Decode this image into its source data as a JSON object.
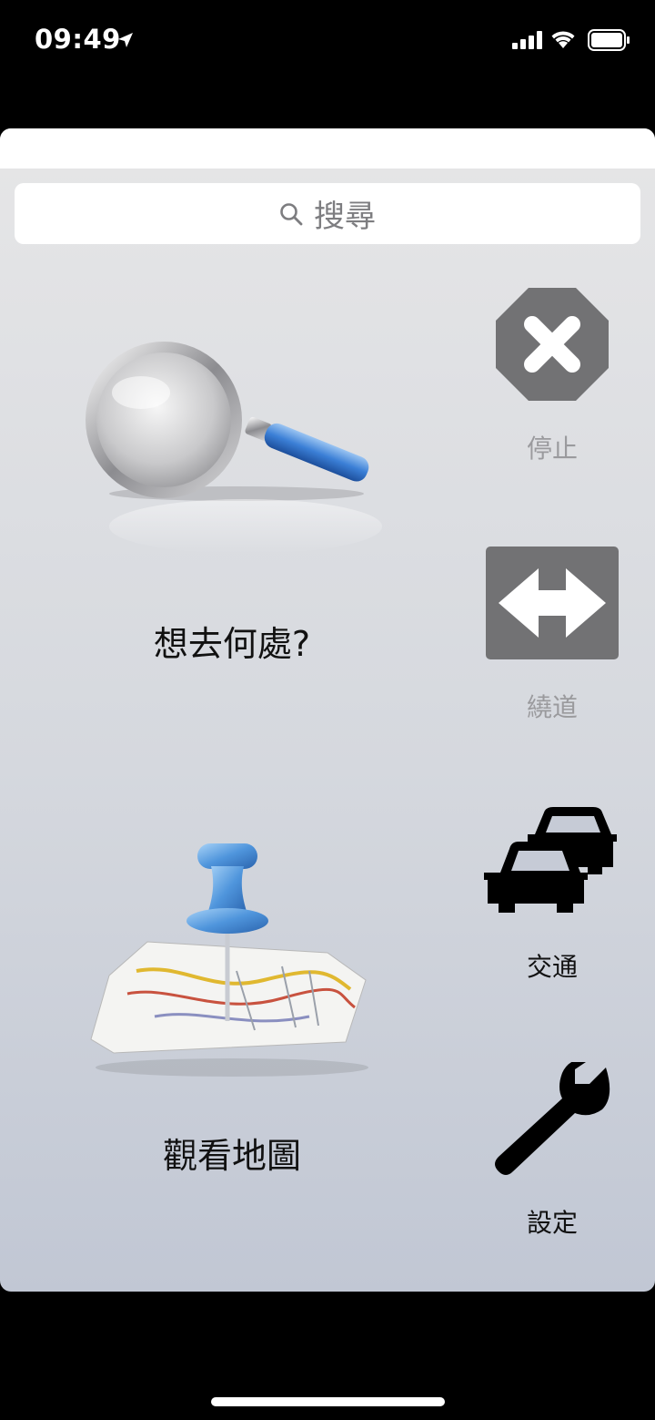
{
  "status_bar": {
    "time": "09:49"
  },
  "search": {
    "placeholder": "搜尋"
  },
  "main": {
    "where_to": "想去何處?",
    "view_map": "觀看地圖"
  },
  "side": {
    "stop": "停止",
    "detour": "繞道",
    "traffic": "交通",
    "settings": "設定"
  },
  "colors": {
    "disabled_icon": "#727274",
    "enabled_icon": "#000000",
    "disabled_label": "#9a9a9d"
  }
}
